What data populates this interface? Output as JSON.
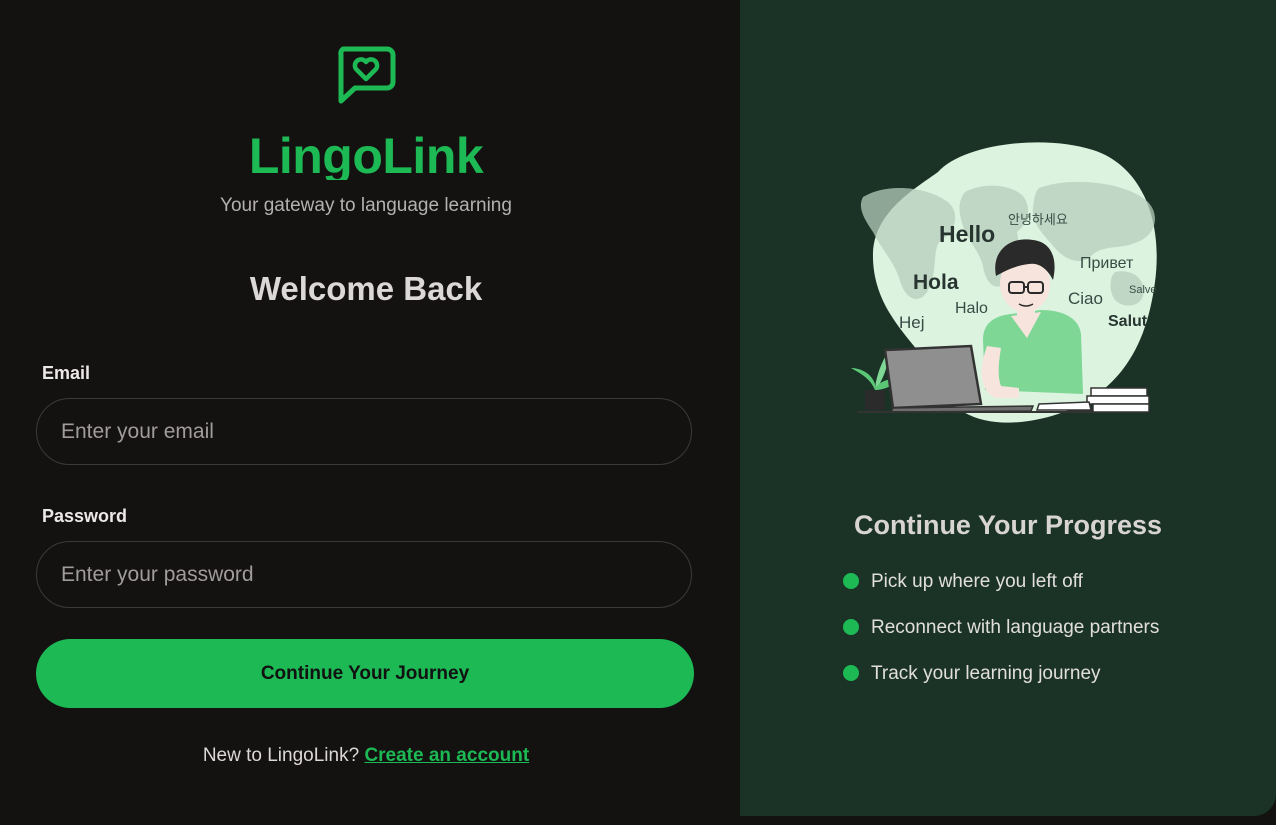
{
  "brand": {
    "name": "LingoLink",
    "tagline": "Your gateway to language learning",
    "icon": "chat-heart-icon",
    "color": "#1db954"
  },
  "form": {
    "heading": "Welcome Back",
    "email": {
      "label": "Email",
      "placeholder": "Enter your email",
      "value": ""
    },
    "password": {
      "label": "Password",
      "placeholder": "Enter your password",
      "value": ""
    },
    "submit_label": "Continue Your Journey",
    "signup_prompt": "New to LingoLink?",
    "signup_link": "Create an account"
  },
  "panel": {
    "illustration": {
      "words": [
        "Hello",
        "안녕하세요",
        "Hola",
        "Привет",
        "Halo",
        "Ciao",
        "Salve",
        "Hej",
        "Salut"
      ]
    },
    "title": "Continue Your Progress",
    "bullets": [
      "Pick up where you left off",
      "Reconnect with language partners",
      "Track your learning journey"
    ]
  },
  "colors": {
    "accent": "#1db954",
    "left_bg": "#141111",
    "right_bg": "#1a3326"
  }
}
